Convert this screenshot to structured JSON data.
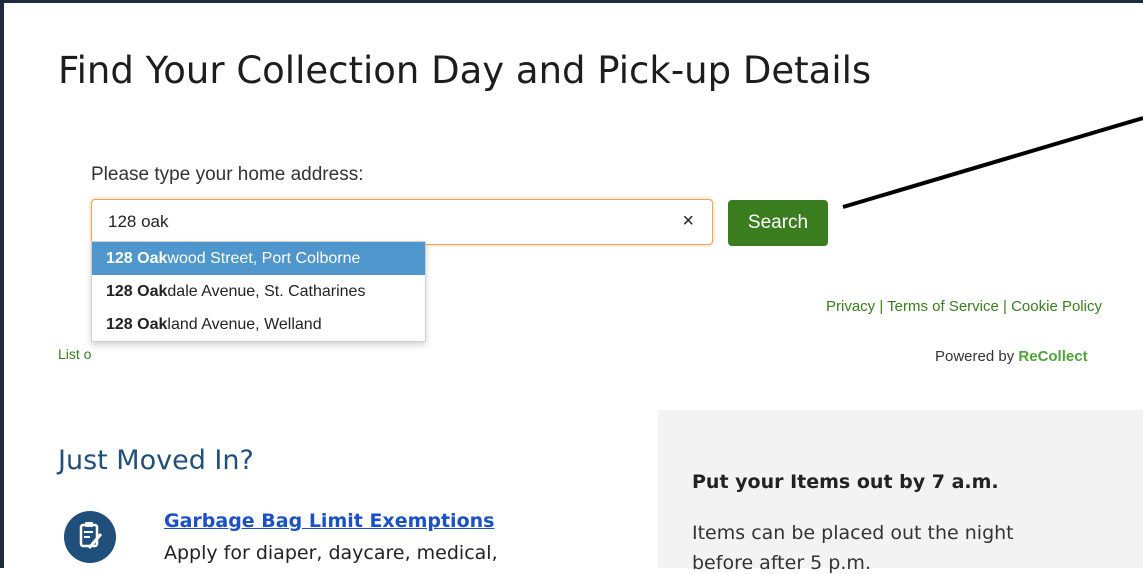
{
  "page": {
    "title": "Find Your Collection Day and Pick-up Details"
  },
  "search": {
    "label": "Please type your home address:",
    "value": "128 oak",
    "clear_label": "×",
    "button_label": "Search"
  },
  "suggestions": [
    {
      "match": "128 Oak",
      "rest": "wood Street, Port Colborne"
    },
    {
      "match": "128 Oak",
      "rest": "dale Avenue, St. Catharines"
    },
    {
      "match": "128 Oak",
      "rest": "land Avenue, Welland"
    }
  ],
  "list_link": "List o",
  "footer": {
    "privacy": "Privacy",
    "sep": " | ",
    "terms": "Terms of Service",
    "cookie": "Cookie Policy",
    "powered_by": "Powered by ",
    "brand": "ReCollect"
  },
  "moved": {
    "title": "Just Moved In?",
    "link": "Garbage Bag Limit Exemptions",
    "desc": "Apply for diaper, daycare, medical,",
    "icon": "clipboard-edit-icon"
  },
  "panel": {
    "title": "Put your Items out by 7 a.m.",
    "line1": "Items can be placed out the night",
    "line2": "before after 5 p.m."
  },
  "colors": {
    "accent_green": "#3a7d1e",
    "highlight_blue": "#4e96cb",
    "heading_blue": "#1f4f7a",
    "link_blue": "#1a50c8",
    "focus_orange": "#f0a356"
  }
}
